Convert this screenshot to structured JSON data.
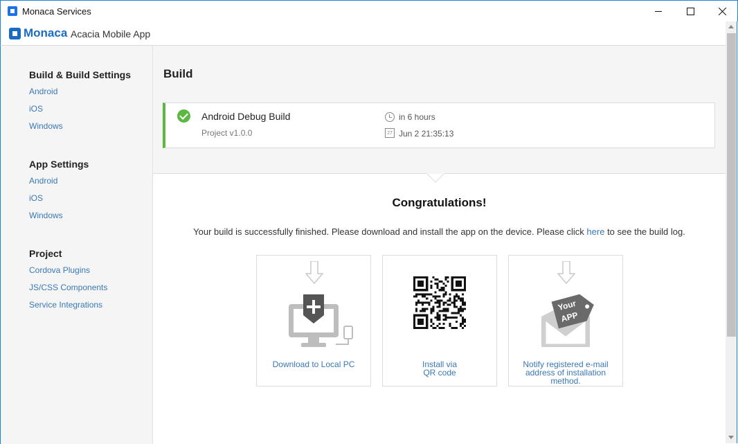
{
  "window": {
    "title": "Monaca Services"
  },
  "header": {
    "logo": "Monaca",
    "project": "Acacia Mobile App"
  },
  "sidebar": {
    "sections": [
      {
        "heading": "Build & Build Settings",
        "links": [
          "Android",
          "iOS",
          "Windows"
        ]
      },
      {
        "heading": "App Settings",
        "links": [
          "Android",
          "iOS",
          "Windows"
        ]
      },
      {
        "heading": "Project",
        "links": [
          "Cordova Plugins",
          "JS/CSS Components",
          "Service Integrations"
        ]
      }
    ]
  },
  "main": {
    "title": "Build",
    "build": {
      "name": "Android Debug Build",
      "project": "Project v1.0.0",
      "expires": "in 6 hours",
      "calendar_day": "27",
      "date": "Jun 2 21:35:13"
    },
    "congrats": "Congratulations!",
    "message_before": "Your build is successfully finished. Please download and install the app on the device. Please click ",
    "message_link": "here",
    "message_after": " to see the build log.",
    "tiles": {
      "download": "Download to Local PC",
      "qr_line1": "Install via",
      "qr_line2": "QR code",
      "notify_line1": "Notify registered e-mail",
      "notify_line2": "address of installation",
      "notify_line3": "method.",
      "notify_badge1": "Your",
      "notify_badge2": "APP"
    }
  },
  "colors": {
    "accent": "#3a78b8",
    "success": "#5bb941",
    "brand": "#1a6cc2"
  }
}
